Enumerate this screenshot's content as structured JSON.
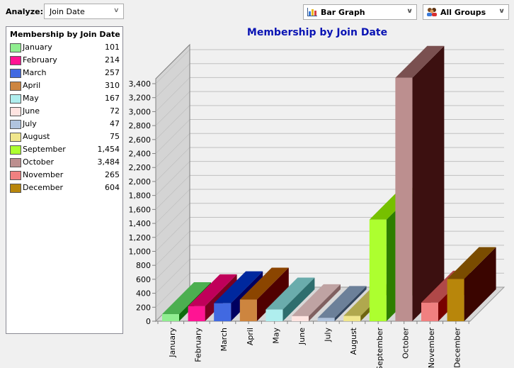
{
  "toolbar": {
    "analyze_label": "Analyze:",
    "analyze_value": "Join Date",
    "graph_type_value": "Bar Graph",
    "graph_type_icon": "bar-chart-icon",
    "group_value": "All Groups",
    "group_icon": "people-group-icon",
    "dropdown_icon": "chevron-down-icon"
  },
  "legend": {
    "title": "Membership by Join Date",
    "items": [
      {
        "label": "January",
        "value": "101",
        "color": "#90ee90"
      },
      {
        "label": "February",
        "value": "214",
        "color": "#ff1493"
      },
      {
        "label": "March",
        "value": "257",
        "color": "#4169e1"
      },
      {
        "label": "April",
        "value": "310",
        "color": "#cd853f"
      },
      {
        "label": "May",
        "value": "167",
        "color": "#afeeee"
      },
      {
        "label": "June",
        "value": "72",
        "color": "#ffe4e1"
      },
      {
        "label": "July",
        "value": "47",
        "color": "#b0c4de"
      },
      {
        "label": "August",
        "value": "75",
        "color": "#f0e68c"
      },
      {
        "label": "September",
        "value": "1,454",
        "color": "#adff2f"
      },
      {
        "label": "October",
        "value": "3,484",
        "color": "#bc8f8f"
      },
      {
        "label": "November",
        "value": "265",
        "color": "#f08080"
      },
      {
        "label": "December",
        "value": "604",
        "color": "#b8860b"
      }
    ]
  },
  "chart_data": {
    "type": "bar",
    "title": "Membership by Join Date",
    "xlabel": "",
    "ylabel": "",
    "categories": [
      "January",
      "February",
      "March",
      "April",
      "May",
      "June",
      "July",
      "August",
      "September",
      "October",
      "November",
      "December"
    ],
    "values": [
      101,
      214,
      257,
      310,
      167,
      72,
      47,
      75,
      1454,
      3484,
      265,
      604
    ],
    "colors": {
      "front": [
        "#90ee90",
        "#ff1493",
        "#4169e1",
        "#cd853f",
        "#afeeee",
        "#ffe4e1",
        "#b0c4de",
        "#f0e68c",
        "#adff2f",
        "#bc8f8f",
        "#f08080",
        "#b8860b"
      ],
      "top": [
        "#4caf50",
        "#c0005a",
        "#00289e",
        "#8b4500",
        "#6aacac",
        "#bfa3a3",
        "#6c8099",
        "#b0a84e",
        "#76c000",
        "#7a5050",
        "#b04848",
        "#7a4c00"
      ],
      "side": [
        "#0c6b0c",
        "#7a0020",
        "#000060",
        "#500000",
        "#2e6e6e",
        "#806060",
        "#34465e",
        "#6e6410",
        "#2e7e00",
        "#3c1010",
        "#780000",
        "#3a0500"
      ]
    },
    "ylim": [
      0,
      3400
    ],
    "yticks": [
      0,
      200,
      400,
      600,
      800,
      1000,
      1200,
      1400,
      1600,
      1800,
      2000,
      2200,
      2400,
      2600,
      2800,
      3000,
      3200,
      3400
    ],
    "ytick_labels": [
      "0",
      "200",
      "400",
      "600",
      "800",
      "1,000",
      "1,200",
      "1,400",
      "1,600",
      "1,800",
      "2,000",
      "2,200",
      "2,400",
      "2,600",
      "2,800",
      "3,000",
      "3,200",
      "3,400"
    ],
    "grid": true,
    "style": "3d",
    "legend_position": "left"
  }
}
